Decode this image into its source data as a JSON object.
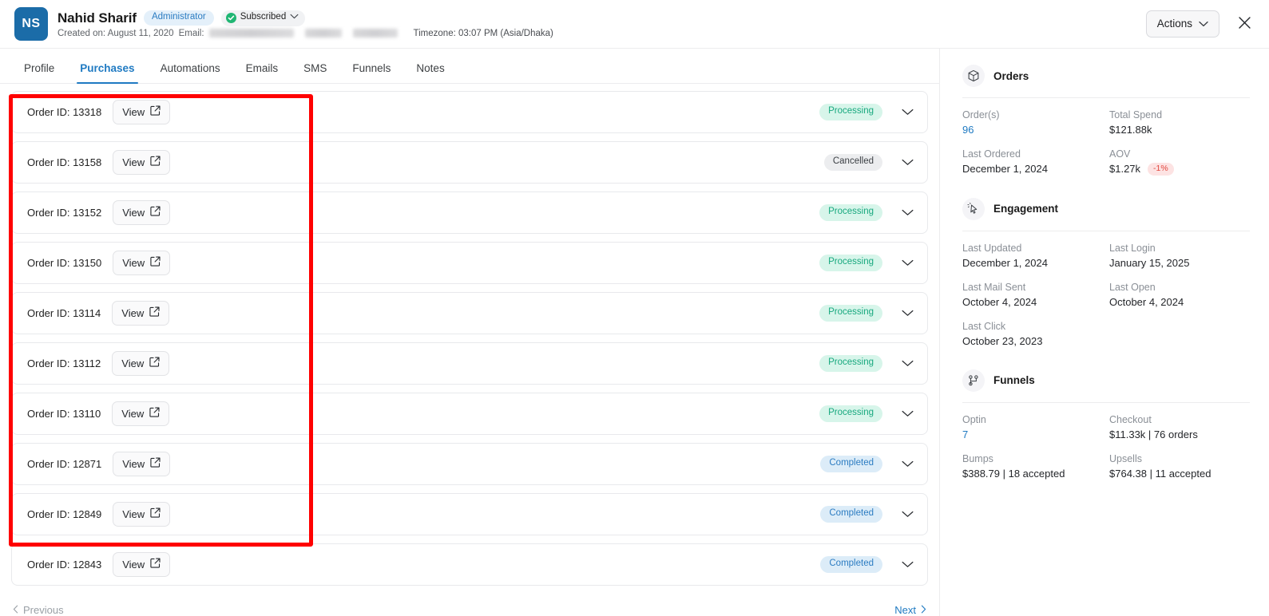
{
  "header": {
    "avatar_initials": "NS",
    "name": "Nahid Sharif",
    "role_badge": "Administrator",
    "subscription_badge": "Subscribed",
    "created_label": "Created on: August 11, 2020",
    "email_label": "Email:",
    "timezone": "Timezone: 03:07 PM (Asia/Dhaka)",
    "actions_label": "Actions",
    "close_icon": "close-icon",
    "chevron_icon": "chevron-down-icon"
  },
  "tabs": [
    {
      "label": "Profile",
      "active": false
    },
    {
      "label": "Purchases",
      "active": true
    },
    {
      "label": "Automations",
      "active": false
    },
    {
      "label": "Emails",
      "active": false
    },
    {
      "label": "SMS",
      "active": false
    },
    {
      "label": "Funnels",
      "active": false
    },
    {
      "label": "Notes",
      "active": false
    }
  ],
  "orders_list": {
    "view_label": "View",
    "rows": [
      {
        "order_id": "Order ID: 13318",
        "status": "Processing",
        "status_kind": "processing"
      },
      {
        "order_id": "Order ID: 13158",
        "status": "Cancelled",
        "status_kind": "cancelled"
      },
      {
        "order_id": "Order ID: 13152",
        "status": "Processing",
        "status_kind": "processing"
      },
      {
        "order_id": "Order ID: 13150",
        "status": "Processing",
        "status_kind": "processing"
      },
      {
        "order_id": "Order ID: 13114",
        "status": "Processing",
        "status_kind": "processing"
      },
      {
        "order_id": "Order ID: 13112",
        "status": "Processing",
        "status_kind": "processing"
      },
      {
        "order_id": "Order ID: 13110",
        "status": "Processing",
        "status_kind": "processing"
      },
      {
        "order_id": "Order ID: 12871",
        "status": "Completed",
        "status_kind": "completed"
      },
      {
        "order_id": "Order ID: 12849",
        "status": "Completed",
        "status_kind": "completed"
      },
      {
        "order_id": "Order ID: 12843",
        "status": "Completed",
        "status_kind": "completed"
      }
    ]
  },
  "pagination": {
    "previous_label": "Previous",
    "next_label": "Next"
  },
  "sidebar": {
    "orders": {
      "title": "Orders",
      "icon": "package-icon",
      "fields": [
        {
          "label": "Order(s)",
          "value": "96",
          "link": true
        },
        {
          "label": "Total Spend",
          "value": "$121.88k",
          "link": false
        },
        {
          "label": "Last Ordered",
          "value": "December 1, 2024",
          "link": false
        },
        {
          "label": "AOV",
          "value": "$1.27k",
          "link": false,
          "delta": "-1%"
        }
      ]
    },
    "engagement": {
      "title": "Engagement",
      "icon": "cursor-click-icon",
      "fields": [
        {
          "label": "Last Updated",
          "value": "December 1, 2024"
        },
        {
          "label": "Last Login",
          "value": "January 15, 2025"
        },
        {
          "label": "Last Mail Sent",
          "value": "October 4, 2024"
        },
        {
          "label": "Last Open",
          "value": "October 4, 2024"
        },
        {
          "label": "Last Click",
          "value": "October 23, 2023"
        }
      ]
    },
    "funnels": {
      "title": "Funnels",
      "icon": "funnel-nodes-icon",
      "fields": [
        {
          "label": "Optin",
          "value": "7",
          "link": true
        },
        {
          "label": "Checkout",
          "value": "$11.33k | 76 orders",
          "link": false
        },
        {
          "label": "Bumps",
          "value": "$388.79 | 18 accepted",
          "link": false
        },
        {
          "label": "Upsells",
          "value": "$764.38 | 11 accepted",
          "link": false
        }
      ]
    }
  },
  "colors": {
    "accent": "#1f7ac2",
    "processing": "#17a87e",
    "processing_bg": "#d7f5ea",
    "completed": "#2b7cc2",
    "completed_bg": "#dcecf8",
    "cancelled": "#3b3f44",
    "cancelled_bg": "#ecedef",
    "negative": "#e2483f",
    "annotation": "#ff0000",
    "avatar": "#1b6ca8"
  }
}
